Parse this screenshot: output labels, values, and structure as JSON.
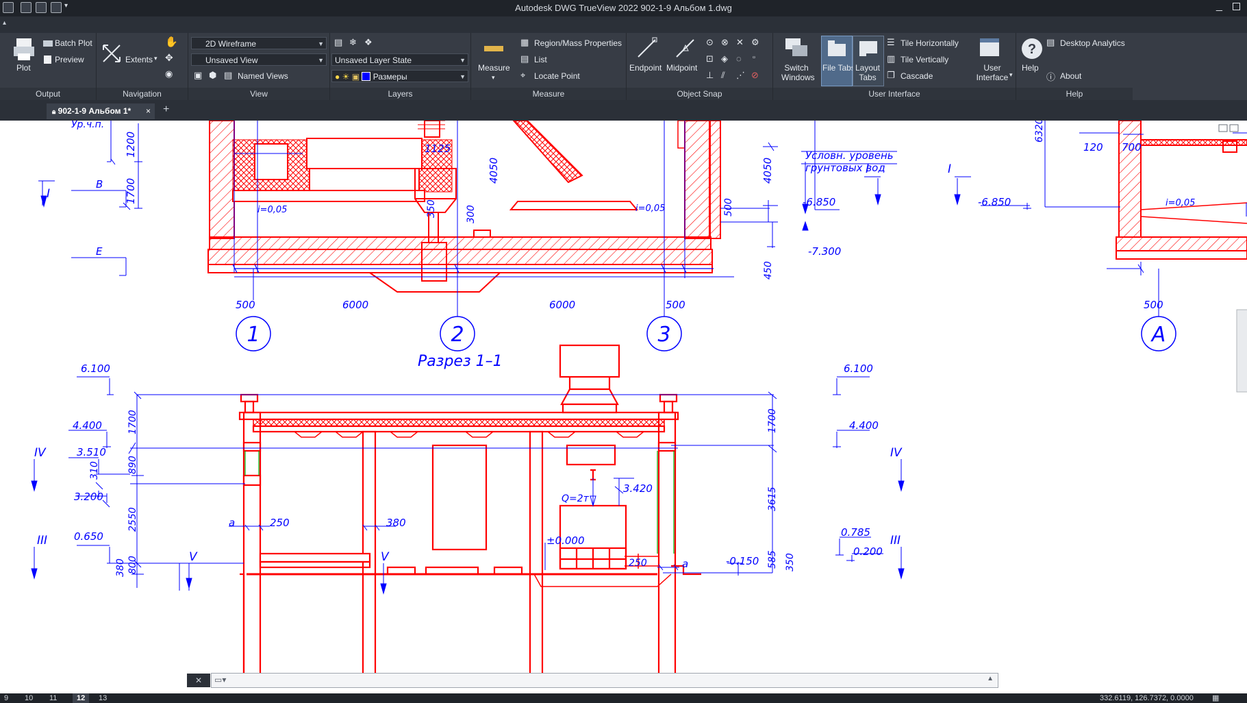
{
  "window": {
    "title": "Autodesk DWG TrueView 2022    902-1-9 Альбом 1.dwg"
  },
  "ribbon": {
    "output": {
      "title": "Output",
      "plot": "Plot",
      "batch_plot": "Batch Plot",
      "preview": "Preview"
    },
    "navigation": {
      "title": "Navigation",
      "extents": "Extents"
    },
    "view": {
      "title": "View",
      "visual_style": "2D Wireframe",
      "layer_state_view": "Unsaved View",
      "named_views": "Named Views"
    },
    "layers": {
      "title": "Layers",
      "layer_state": "Unsaved Layer State",
      "current_layer": "Размеры",
      "current_layer_color": "#0000ff"
    },
    "measure": {
      "title": "Measure",
      "measure": "Measure",
      "region_props": "Region/Mass Properties",
      "list": "List",
      "locate_point": "Locate Point"
    },
    "object_snap": {
      "title": "Object Snap",
      "endpoint": "Endpoint",
      "midpoint": "Midpoint"
    },
    "user_interface": {
      "title": "User Interface",
      "switch_windows": "Switch Windows",
      "file_tabs": "File Tabs",
      "layout_tabs": "Layout Tabs",
      "tile_h": "Tile Horizontally",
      "tile_v": "Tile Vertically",
      "cascade": "Cascade",
      "user_interface": "User Interface"
    },
    "help": {
      "title": "Help",
      "help": "Help",
      "desktop_analytics": "Desktop Analytics",
      "about": "About"
    }
  },
  "file_tab": {
    "label": "902-1-9 Альбом 1*"
  },
  "drawing": {
    "section_title": "Разрез 1–1",
    "axes": [
      "1",
      "2",
      "3",
      "А"
    ],
    "note_groundwater": [
      "Условн. уровень",
      "грунтовых вод"
    ],
    "elev_top": {
      "urchp": "Ур.ч.п.",
      "b": "В",
      "e": "Е",
      "el_6850_a": "-6.850",
      "el_6850_b": "-6.850",
      "el_7300": "-7.300"
    },
    "dims_top": {
      "d1200": "1200",
      "d1700": "1700",
      "d1125": "1125",
      "d4050a": "4050",
      "d4050b": "4050",
      "d350": "350",
      "d300": "300",
      "d500": "500",
      "d450": "450",
      "d500a": "500",
      "d6000a": "6000",
      "d6000b": "6000",
      "d500b": "500",
      "d500c": "500",
      "d6320": "6320",
      "d120": "120",
      "d700": "700"
    },
    "slopes": {
      "s1": "i=0,05",
      "s2": "i=0,05",
      "s3": "i=0,05"
    },
    "sections": {
      "I": "I",
      "III": "III",
      "IV": "IV",
      "V": "V"
    },
    "elev_bottom": {
      "e6100a": "6.100",
      "e6100b": "6.100",
      "e4400a": "4.400",
      "e4400b": "4.400",
      "e3510": "3.510",
      "e3200": "3.200",
      "e0650": "0.650",
      "e3420": "3.420",
      "e0000": "±0.000",
      "e0785": "0.785",
      "e0200": "0.200",
      "e0150": "-0.150"
    },
    "dims_bottom": {
      "d1700a": "1700",
      "d890": "890",
      "d310": "310",
      "d2550": "2550",
      "d380": "380",
      "d800": "800",
      "d1700b": "1700",
      "d3615": "3615",
      "d585": "585",
      "d350": "350",
      "d250a": "250",
      "d380b": "380",
      "d250b": "250"
    },
    "labels": {
      "a1": "a",
      "a2": "a",
      "load": "Q=2т"
    }
  },
  "statusbar": {
    "layout_tabs": [
      "9",
      "10",
      "11",
      "12",
      "13"
    ],
    "active_tab": "12",
    "coords": "332.6119, 126.7372, 0.0000"
  }
}
